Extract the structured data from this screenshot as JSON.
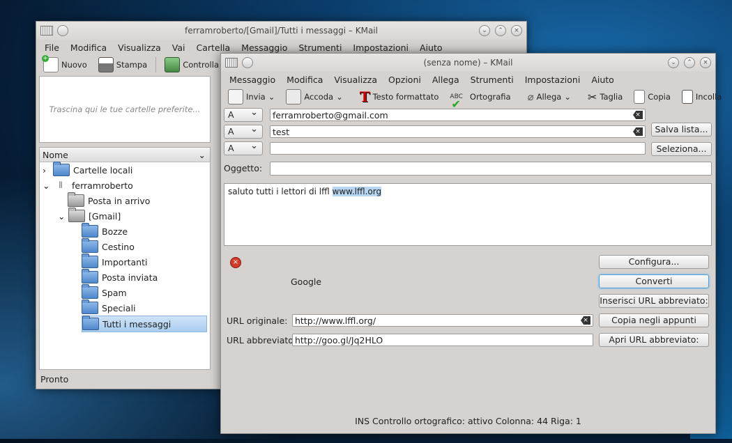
{
  "main": {
    "title": "ferramroberto/[Gmail]/Tutti i messaggi – KMail",
    "menu": [
      "File",
      "Modifica",
      "Visualizza",
      "Vai",
      "Cartella",
      "Messaggio",
      "Strumenti",
      "Impostazioni",
      "Aiuto"
    ],
    "toolbar": {
      "new": "Nuovo",
      "print": "Stampa",
      "check": "Controlla posta"
    },
    "favorites_hint": "Trascina qui le tue cartelle preferite...",
    "tree_header": "Nome",
    "tree": {
      "local": "Cartelle locali",
      "account": "ferramroberto",
      "inbox": "Posta in arrivo",
      "gmail": "[Gmail]",
      "bozze": "Bozze",
      "cestino": "Cestino",
      "importanti": "Importanti",
      "inviata": "Posta inviata",
      "spam": "Spam",
      "speciali": "Speciali",
      "tutti": "Tutti i messaggi"
    },
    "status": "Pronto"
  },
  "composer": {
    "title": "(senza nome) – KMail",
    "menu": [
      "Messaggio",
      "Modifica",
      "Visualizza",
      "Opzioni",
      "Allega",
      "Strumenti",
      "Impostazioni",
      "Aiuto"
    ],
    "toolbar": {
      "send": "Invia",
      "queue": "Accoda",
      "formatted": "Testo formattato",
      "spell": "Ortografia",
      "attach": "Allega",
      "cut": "Taglia",
      "copy": "Copia",
      "paste": "Incolla",
      "more": "›"
    },
    "recipients": [
      {
        "type": "A",
        "value": "ferramroberto@gmail.com"
      },
      {
        "type": "A",
        "value": "test"
      },
      {
        "type": "A",
        "value": ""
      }
    ],
    "save_list": "Salva lista...",
    "select": "Seleziona...",
    "subject_label": "Oggetto:",
    "subject_value": "",
    "body_text": "saluto tutti i lettori di lffl ",
    "body_link": "www.lffl.org",
    "shortener": {
      "service": "Google",
      "configure": "Configura...",
      "convert": "Converti",
      "insert": "Inserisci URL abbreviato:",
      "copy_clip": "Copia negli appunti",
      "open": "Apri URL abbreviato:",
      "orig_label": "URL originale:",
      "orig_value": "http://www.lffl.org/",
      "short_label": "URL abbreviato:",
      "short_value": "http://goo.gl/Jq2HLO"
    },
    "status": "INS  Controllo ortografico: attivo   Colonna: 44   Riga: 1"
  }
}
